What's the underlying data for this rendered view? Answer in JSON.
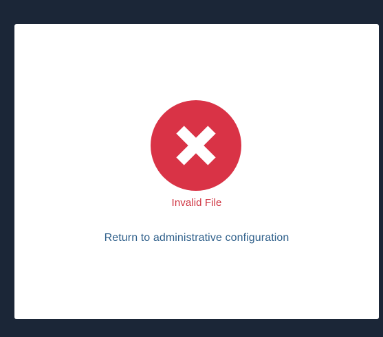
{
  "dialog": {
    "icon": "error-x-circle-icon",
    "status_text": "Invalid File",
    "return_link_label": "Return to administrative configuration"
  },
  "colors": {
    "background": "#1b2637",
    "dialog": "#ffffff",
    "error_red": "#d93346",
    "link_blue": "#2e5f8a"
  }
}
